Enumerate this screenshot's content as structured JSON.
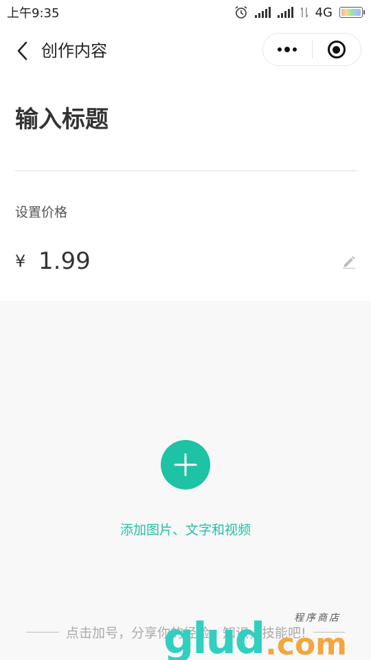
{
  "status_bar": {
    "time": "上午9:35",
    "network": "4G"
  },
  "nav": {
    "title": "创作内容",
    "icons": {
      "back": "chevron-left-icon",
      "more": "more-dots-icon",
      "close": "target-close-icon"
    }
  },
  "form": {
    "title_placeholder": "输入标题",
    "price_label": "设置价格",
    "currency_symbol": "¥",
    "price_value": "1.99"
  },
  "content": {
    "add_hint": "添加图片、文字和视频",
    "footer_hint": "点击加号，分享你的经验，知识，技能吧!",
    "accent_color": "#1ec2a5"
  },
  "watermark": {
    "brand": "glud",
    "suffix": ".com",
    "subtitle": "程序商店"
  }
}
